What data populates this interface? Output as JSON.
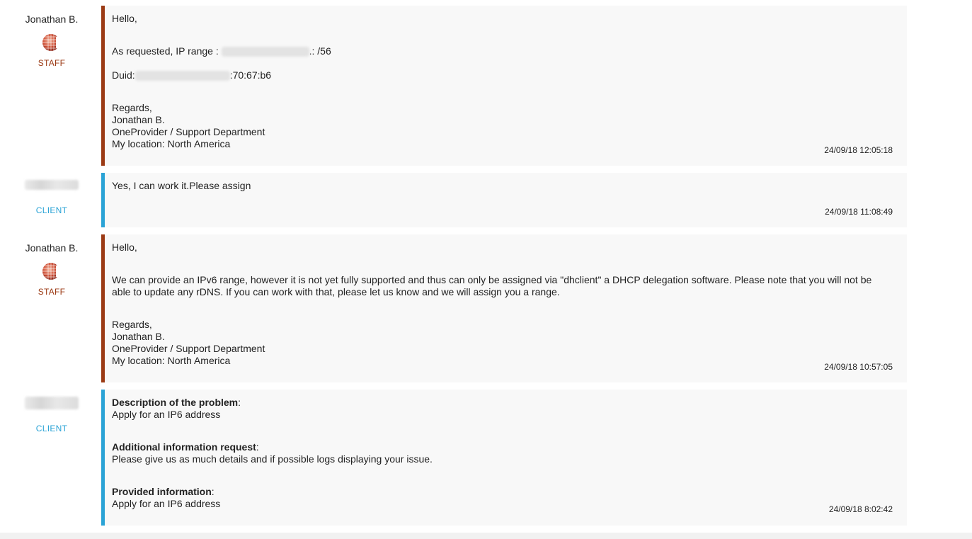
{
  "messages": [
    {
      "author": "Jonathan B.",
      "role": "STAFF",
      "greeting": "Hello,",
      "ip_prefix": "As requested, IP range : ",
      "ip_suffix": ".: /56",
      "duid_prefix": "Duid:",
      "duid_suffix": ":70:67:b6",
      "sign_regards": "Regards,",
      "sign_name": "Jonathan B.",
      "sign_dept": "OneProvider / Support Department",
      "sign_location": "My location: North America",
      "timestamp": "24/09/18 12:05:18"
    },
    {
      "role": "CLIENT",
      "text": "Yes, I can work it.Please assign",
      "timestamp": "24/09/18 11:08:49"
    },
    {
      "author": "Jonathan B.",
      "role": "STAFF",
      "greeting": "Hello,",
      "line1": "We can provide an IPv6 range, however it is not yet fully supported and thus can only be assigned via \"dhclient\" a DHCP delegation software. Please note that you will not be",
      "line2": "able to update any rDNS. If you can work with that, please let us know and we will assign you a range.",
      "sign_regards": "Regards,",
      "sign_name": "Jonathan B.",
      "sign_dept": "OneProvider / Support Department",
      "sign_location": "My location: North America",
      "timestamp": "24/09/18 10:57:05"
    },
    {
      "role": "CLIENT",
      "problem_label": "Description of the problem",
      "problem_text": "Apply for an IP6 address",
      "additional_label": "Additional information request",
      "additional_text": "Please give us as much details and if possible logs displaying your issue.",
      "provided_label": "Provided information",
      "provided_text": "Apply for an IP6 address",
      "colon": ":",
      "timestamp": "24/09/18 8:02:42"
    }
  ],
  "colors": {
    "staff_accent": "#9b3a14",
    "client_accent": "#2aa3d6",
    "bubble_bg": "#f8f8f8"
  },
  "icons": {
    "staff_avatar": "globe-logo-icon"
  }
}
